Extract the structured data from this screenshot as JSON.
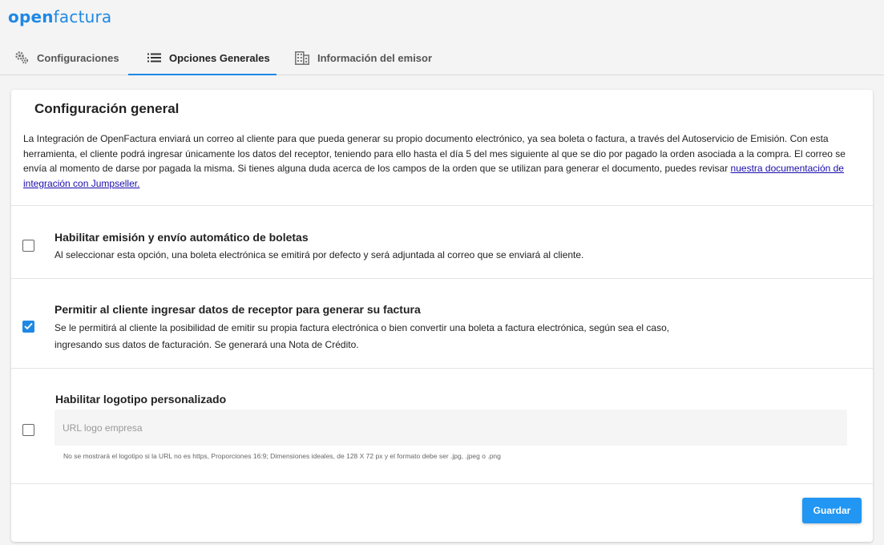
{
  "brand": {
    "logo_open": "open",
    "logo_factura": "factura",
    "color": "#1e88e5"
  },
  "tabs": [
    {
      "label": "Configuraciones",
      "icon": "gears-icon",
      "active": false
    },
    {
      "label": "Opciones Generales",
      "icon": "list-icon",
      "active": true
    },
    {
      "label": "Información del emisor",
      "icon": "building-icon",
      "active": false
    }
  ],
  "card": {
    "title": "Configuración general",
    "intro_text": "La Integración de OpenFactura enviará un correo al cliente para que pueda generar su propio documento electrónico, ya sea boleta o factura, a través del Autoservicio de Emisión. Con esta herramienta, el cliente podrá ingresar únicamente los datos del receptor, teniendo para ello hasta el día 5 del mes siguiente al que se dio por pagado la orden asociada a la compra. El correo se envía al momento de darse por pagada la misma. Si tienes alguna duda acerca de los campos de la orden que se utilizan para generar el documento, puedes revisar ",
    "intro_link": "nuestra documentación de integración con Jumpseller."
  },
  "options": [
    {
      "title": "Habilitar emisión y envío automático de boletas",
      "desc_line1": "Al seleccionar esta opción, una boleta electrónica se emitirá por defecto y será adjuntada al correo que se enviará al cliente.",
      "checked": false
    },
    {
      "title": "Permitir al cliente ingresar datos de receptor para generar su factura",
      "desc_line1": "Se le permitirá al cliente la posibilidad de emitir su propia factura electrónica o bien convertir una boleta a factura electrónica, según sea el caso,",
      "desc_line2": "ingresando sus datos de facturación. Se generará una Nota de Crédito.",
      "checked": true
    },
    {
      "title": "Habilitar logotipo personalizado",
      "checked": false,
      "input_placeholder": "URL logo empresa",
      "hint": "No se mostrará el logotipo si la URL no es https, Proporciones 16:9; Dimensiones ideales, de 128 X 72 px y el formato debe ser .jpg, .jpeg o .png"
    }
  ],
  "save_label": "Guardar",
  "colors": {
    "accent": "#1e88e5",
    "button": "#2196f3"
  }
}
